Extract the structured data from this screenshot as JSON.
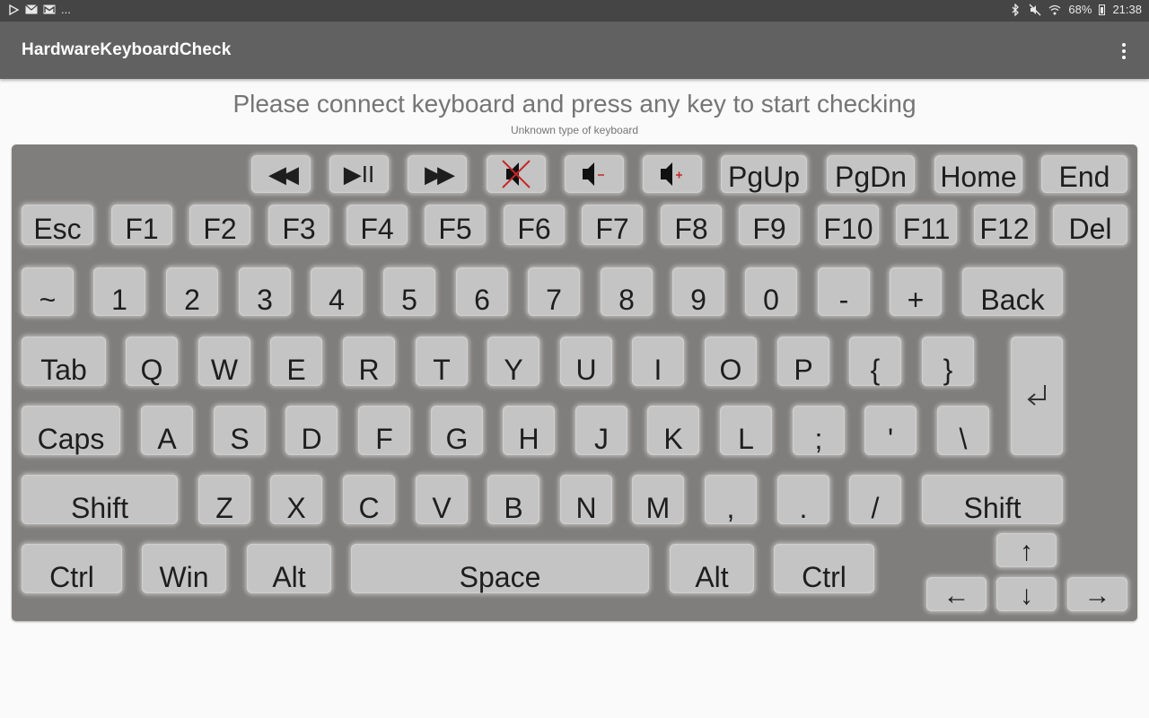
{
  "status_bar": {
    "left_icons": [
      "play-store-icon",
      "mail-icon",
      "gmail-icon"
    ],
    "ellipsis": "...",
    "battery": "68%",
    "time": "21:38"
  },
  "app_bar": {
    "title": "HardwareKeyboardCheck"
  },
  "prompt": "Please connect keyboard and press any key to start checking",
  "subprompt": "Unknown type of keyboard",
  "colors": {
    "key": "#c4c4c4",
    "keyboard_bg": "#7f7e7c",
    "appbar": "#616161",
    "mute_cross": "#c62828",
    "volume_sign": "#c62828"
  },
  "keys": {
    "media": {
      "rewind": "◀◀",
      "play_pause": "▶II",
      "fast_forward": "▶▶",
      "pgup": "PgUp",
      "pgdn": "PgDn",
      "home": "Home",
      "end": "End"
    },
    "function_row": [
      "Esc",
      "F1",
      "F2",
      "F3",
      "F4",
      "F5",
      "F6",
      "F7",
      "F8",
      "F9",
      "F10",
      "F11",
      "F12",
      "Del"
    ],
    "number_row": [
      "~",
      "1",
      "2",
      "3",
      "4",
      "5",
      "6",
      "7",
      "8",
      "9",
      "0",
      "-",
      "+",
      "Back"
    ],
    "qwerty_row": [
      "Tab",
      "Q",
      "W",
      "E",
      "R",
      "T",
      "Y",
      "U",
      "I",
      "O",
      "P",
      "{",
      "}"
    ],
    "home_row": [
      "Caps",
      "A",
      "S",
      "D",
      "F",
      "G",
      "H",
      "J",
      "K",
      "L",
      ";",
      "'",
      "\\"
    ],
    "shift_row": [
      "Shift",
      "Z",
      "X",
      "C",
      "V",
      "B",
      "N",
      "M",
      ",",
      ".",
      "/",
      "Shift"
    ],
    "bottom_row": [
      "Ctrl",
      "Win",
      "Alt",
      "Space",
      "Alt",
      "Ctrl"
    ],
    "arrows": {
      "up": "↑",
      "left": "←",
      "down": "↓",
      "right": "→"
    }
  }
}
